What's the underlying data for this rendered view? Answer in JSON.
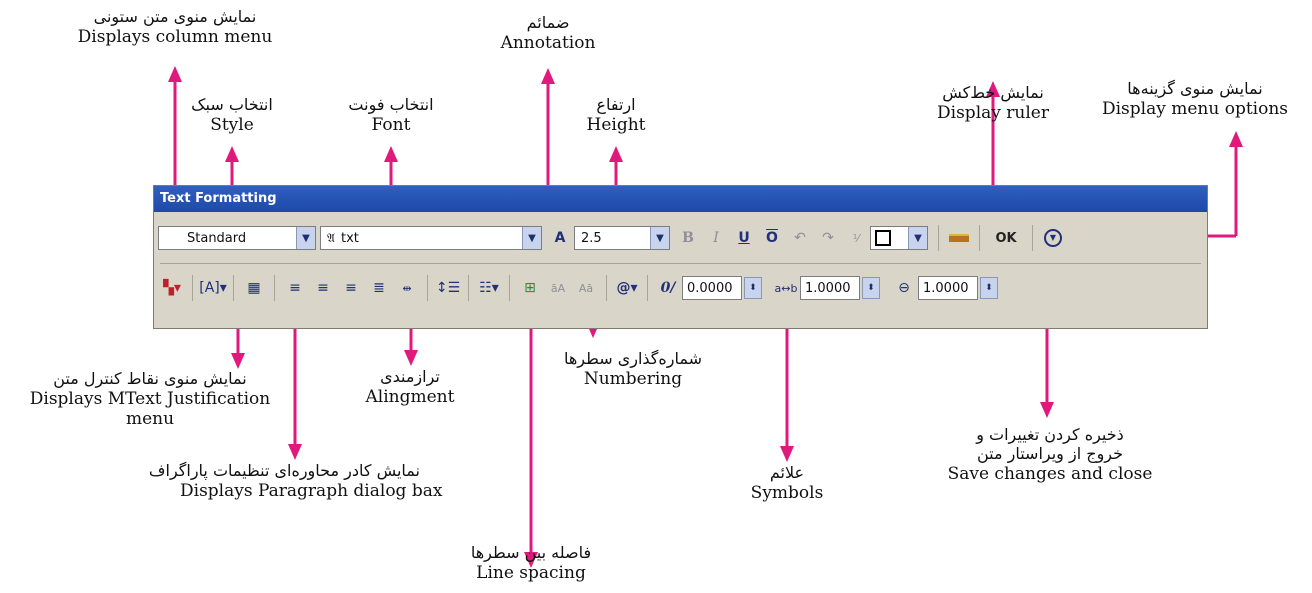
{
  "toolbar": {
    "title": "Text Formatting",
    "style_value": "Standard",
    "font_value": "txt",
    "height_value": "2.5",
    "ok_label": "OK",
    "oblique_value": "0.0000",
    "tracking_value": "1.0000",
    "width_value": "1.0000"
  },
  "labels": {
    "column_menu": {
      "fa": "نمایش منوی متن ستونی",
      "en": "Displays column menu"
    },
    "style": {
      "fa": "انتخاب سبک",
      "en": "Style"
    },
    "font": {
      "fa": "انتخاب فونت",
      "en": "Font"
    },
    "annotation": {
      "fa": "ضمائم",
      "en": "Annotation"
    },
    "height": {
      "fa": "ارتفاع",
      "en": "Height"
    },
    "ruler": {
      "fa": "نمایش خط‌کش",
      "en": "Display ruler"
    },
    "menu_options": {
      "fa": "نمایش منوی گزینه‌ها",
      "en": "Display menu options"
    },
    "justification": {
      "fa": "نمایش منوی نقاط کنترل متن",
      "en": "Displays MText Justification",
      "en2": "menu"
    },
    "alignment": {
      "fa": "ترازمندی",
      "en": "Alingment"
    },
    "numbering": {
      "fa": "شماره‌گذاری سطرها",
      "en": "Numbering"
    },
    "paragraph": {
      "fa": "نمایش کادر محاوره‌ای تنظیمات پاراگراف",
      "en": "Displays Paragraph dialog bax"
    },
    "symbols": {
      "fa": "علائم",
      "en": "Symbols"
    },
    "save": {
      "fa": "ذخیره کردن تغییرات و",
      "fa2": "خروج از ویراستار متن",
      "en": "Save changes and close"
    },
    "line_spacing": {
      "fa": "فاصله بین سطرها",
      "en": "Line spacing"
    }
  },
  "colors": {
    "arrow": "#e0197d",
    "titlebar": "#2f5fc0",
    "toolbar_bg": "#d9d5c8"
  },
  "icons": [
    "column-icon",
    "justification-icon",
    "paragraph-icon",
    "align-left-icon",
    "align-center-icon",
    "align-right-icon",
    "justify-icon",
    "distribute-icon",
    "line-spacing-icon",
    "numbering-icon",
    "insert-field-icon",
    "uppercase-icon",
    "lowercase-icon",
    "symbol-icon",
    "oblique-icon",
    "tracking-icon",
    "width-factor-icon",
    "annotative-icon",
    "bold-icon",
    "italic-icon",
    "underline-icon",
    "overline-icon",
    "undo-icon",
    "redo-icon",
    "stack-icon",
    "color-icon",
    "ruler-icon",
    "options-icon"
  ]
}
